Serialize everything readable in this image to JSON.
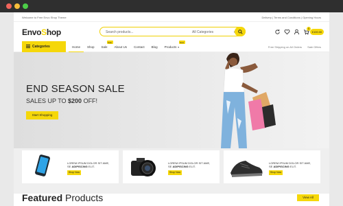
{
  "window": {
    "dots": [
      "#f0645b",
      "#f6bd3b",
      "#4ccd48"
    ]
  },
  "topbar": {
    "welcome": "Welcome to Free Envo Shop Theme",
    "links": "Delivery | Terms and Conditions | Opening Hours"
  },
  "header": {
    "logo_part1": "Envo",
    "logo_part2": "Shop",
    "search_placeholder": "Search products...",
    "category_select": "All Categories",
    "cart_total": "£100.00",
    "cart_count": "0",
    "icons": [
      "refresh-icon",
      "heart-icon",
      "user-icon",
      "cart-icon"
    ]
  },
  "nav": {
    "categories_label": "Categories",
    "links": [
      {
        "label": "Home",
        "active": true
      },
      {
        "label": "Shop"
      },
      {
        "label": "Sale",
        "badge": "Sale"
      },
      {
        "label": "About Us"
      },
      {
        "label": "Contact"
      },
      {
        "label": "Blog"
      },
      {
        "label": "Products",
        "badge": "New"
      }
    ],
    "right": [
      "Free Shipping on All Orders",
      "Sale Offers"
    ]
  },
  "hero": {
    "title": "END SEASON SALE",
    "subtitle_prefix": "SALES UP TO ",
    "subtitle_amount": "$200",
    "subtitle_suffix": " OFF!",
    "cta": "Start Shopping"
  },
  "promos": [
    {
      "line1": "LOREM IPSUM DOLOR SIT AME,",
      "line2_prefix": "SE ",
      "line2_bold": "ADIPISCING",
      "line2_suffix": " ELIT.",
      "button": "Shop Now",
      "image": "phone"
    },
    {
      "line1": "LOREM IPSUM DOLOR SIT AME,",
      "line2_prefix": "SE ",
      "line2_bold": "ADIPISCING",
      "line2_suffix": " ELIT.",
      "button": "Shop Now",
      "image": "camera"
    },
    {
      "line1": "LOREM IPSUM DOLOR SIT AME,",
      "line2_prefix": "SE ",
      "line2_bold": "ADIPISCING",
      "line2_suffix": " ELIT.",
      "button": "Shop Now",
      "image": "shoe"
    }
  ],
  "featured": {
    "word1": "Featured",
    "word2": "Products",
    "view_all": "View All"
  },
  "colors": {
    "accent": "#f5d70a",
    "chrome": "#2f2f2f"
  }
}
